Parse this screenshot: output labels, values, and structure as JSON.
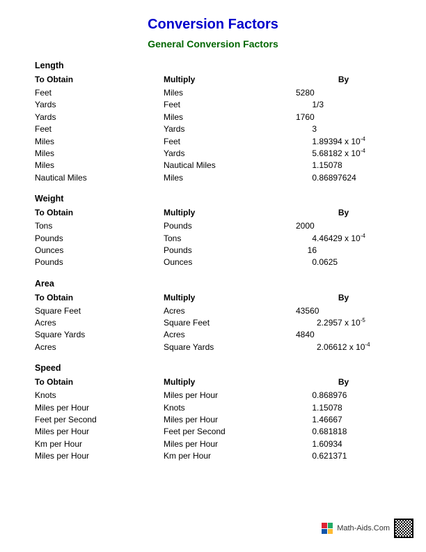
{
  "title": "Conversion Factors",
  "subtitle": "General Conversion Factors",
  "columns": {
    "c1": "To Obtain",
    "c2": "Multiply",
    "c3": "By"
  },
  "sections": [
    {
      "name": "Length",
      "rows": [
        {
          "obtain": "Feet",
          "multiply": "Miles",
          "by": "5280"
        },
        {
          "obtain": "Yards",
          "multiply": "Feet",
          "by": "       1/3"
        },
        {
          "obtain": "Yards",
          "multiply": "Miles",
          "by": "1760"
        },
        {
          "obtain": "Feet",
          "multiply": "Yards",
          "by": "       3"
        },
        {
          "obtain": "Miles",
          "multiply": "Feet",
          "by": "       1.89394 x 10",
          "exp": "-4"
        },
        {
          "obtain": "Miles",
          "multiply": "Yards",
          "by": "       5.68182 x 10",
          "exp": "-4"
        },
        {
          "obtain": "Miles",
          "multiply": "Nautical Miles",
          "by": "       1.15078"
        },
        {
          "obtain": "Nautical Miles",
          "multiply": "Miles",
          "by": "       0.86897624"
        }
      ]
    },
    {
      "name": "Weight",
      "rows": [
        {
          "obtain": "Tons",
          "multiply": "Pounds",
          "by": "2000"
        },
        {
          "obtain": "Pounds",
          "multiply": "Tons",
          "by": "       4.46429 x 10",
          "exp": "-4"
        },
        {
          "obtain": "Ounces",
          "multiply": "Pounds",
          "by": "     16"
        },
        {
          "obtain": "Pounds",
          "multiply": "Ounces",
          "by": "       0.0625"
        }
      ]
    },
    {
      "name": "Area",
      "rows": [
        {
          "obtain": "Square Feet",
          "multiply": "Acres",
          "by": "43560"
        },
        {
          "obtain": "Acres",
          "multiply": "Square Feet",
          "by": "         2.2957 x 10",
          "exp": "-5"
        },
        {
          "obtain": "Square Yards",
          "multiply": "Acres",
          "by": "4840"
        },
        {
          "obtain": "Acres",
          "multiply": "Square Yards",
          "by": "         2.06612 x 10",
          "exp": "-4"
        }
      ]
    },
    {
      "name": "Speed",
      "rows": [
        {
          "obtain": "Knots",
          "multiply": "Miles per Hour",
          "by": "       0.868976"
        },
        {
          "obtain": "Miles per Hour",
          "multiply": "Knots",
          "by": "       1.15078"
        },
        {
          "obtain": "Feet per Second",
          "multiply": "Miles per Hour",
          "by": "       1.46667"
        },
        {
          "obtain": "Miles per Hour",
          "multiply": "Feet per Second",
          "by": "       0.681818"
        },
        {
          "obtain": "Km per Hour",
          "multiply": "Miles per Hour",
          "by": "       1.60934"
        },
        {
          "obtain": "Miles per Hour",
          "multiply": "Km per Hour",
          "by": "       0.621371"
        }
      ]
    }
  ],
  "footer": {
    "site": "Math-Aids.Com"
  }
}
